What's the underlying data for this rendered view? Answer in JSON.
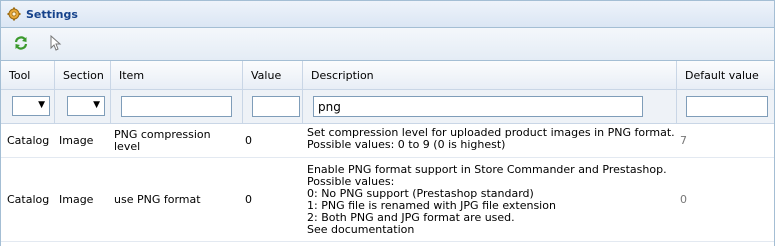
{
  "panel": {
    "title": "Settings"
  },
  "toolbar": {
    "refresh_title": "Refresh",
    "select_title": "Select"
  },
  "columns": [
    "Tool",
    "Section",
    "Item",
    "Value",
    "Description",
    "Default value"
  ],
  "filters": {
    "tool": "",
    "section": "",
    "item": "",
    "value": "",
    "description": "png",
    "default_value": ""
  },
  "rows": [
    {
      "tool": "Catalog",
      "section": "Image",
      "item": "PNG compression level",
      "value": "0",
      "description": "Set compression level for uploaded product images in PNG format.\nPossible values: 0 to 9 (0 is highest)",
      "default_value": "7"
    },
    {
      "tool": "Catalog",
      "section": "Image",
      "item": "use PNG format",
      "value": "0",
      "description": "Enable PNG format support in Store Commander and Prestashop.\nPossible values:\n0: No PNG support (Prestashop standard)\n1: PNG file is renamed with JPG file extension\n2: Both PNG and JPG format are used.\nSee documentation",
      "default_value": "0"
    }
  ],
  "colors": {
    "header_text": "#15428b",
    "border": "#a4bed4",
    "default_value_text": "#777777"
  },
  "icons": {
    "title": "gear-icon",
    "refresh": "refresh-icon",
    "select": "cursor-icon",
    "dropdown": "chevron-down-icon"
  }
}
